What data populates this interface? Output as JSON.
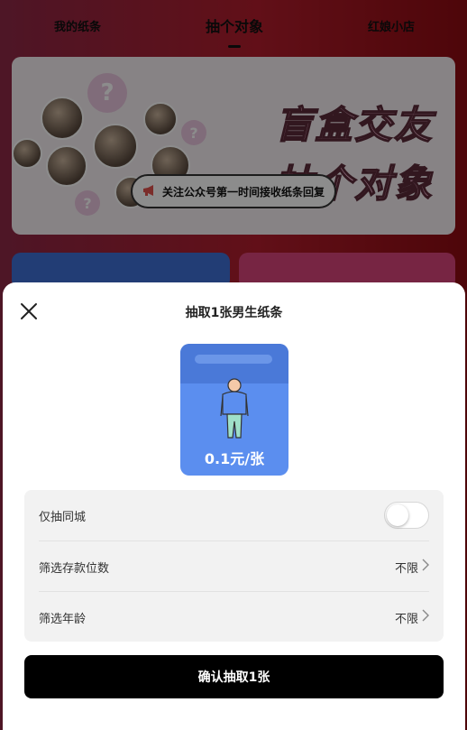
{
  "top_tabs": {
    "left": "我的纸条",
    "center": "抽个对象",
    "right": "红娘小店"
  },
  "banner": {
    "title_line1": "盲盒交友",
    "title_line2": "抽个对象",
    "notice": "关注公众号第一时间接收纸条回复",
    "question_mark": "?"
  },
  "sheet": {
    "title": "抽取1张男生纸条",
    "ticket_price": "0.1元/张",
    "options": [
      {
        "label": "仅抽同城",
        "control": "toggle",
        "value": "off"
      },
      {
        "label": "筛选存款位数",
        "value": "不限"
      },
      {
        "label": "筛选年龄",
        "value": "不限"
      }
    ],
    "confirm_label": "确认抽取1张"
  },
  "colors": {
    "confirm_bg": "#000000",
    "ticket_blue": "#5b8eef"
  }
}
